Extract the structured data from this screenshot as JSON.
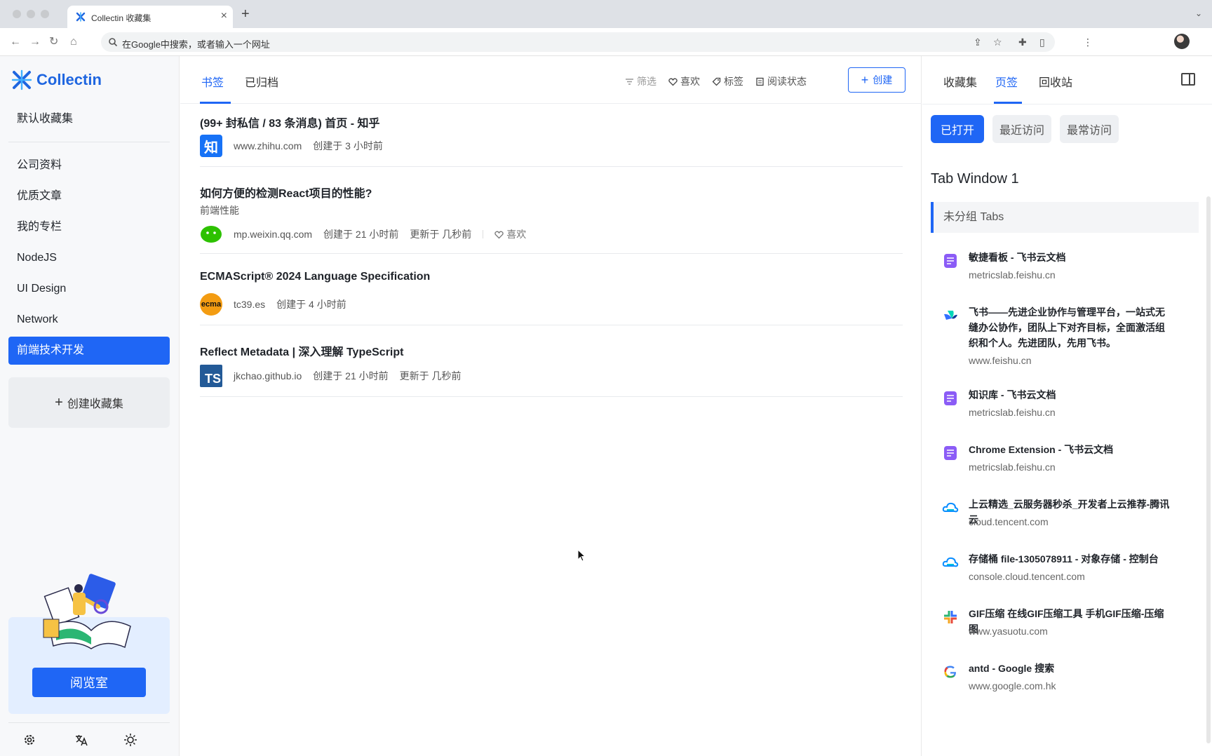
{
  "browser": {
    "tab_title": "Collectin 收藏集",
    "omnibox_placeholder": "在Google中搜索，或者输入一个网址"
  },
  "sidebar": {
    "brand": "Collectin",
    "default_collection": "默认收藏集",
    "items": [
      "公司资料",
      "优质文章",
      "我的专栏",
      "NodeJS",
      "UI Design",
      "Network",
      "前端技术开发"
    ],
    "active_index": 6,
    "create_collection": "创建收藏集",
    "reading_room": "阅览室"
  },
  "main": {
    "tabs": [
      "书签",
      "已归档"
    ],
    "toolbar": {
      "filter": "筛选",
      "like": "喜欢",
      "tags": "标签",
      "read_status": "阅读状态",
      "create": "创建"
    },
    "bookmarks": [
      {
        "title": "(99+ 封私信 / 83 条消息) 首页 - 知乎",
        "desc": "",
        "domain": "www.zhihu.com",
        "created": "创建于 3 小时前",
        "updated": "",
        "like": "",
        "favicon": "zhihu-icon"
      },
      {
        "title": "如何方便的检测React项目的性能?",
        "desc": "前端性能",
        "domain": "mp.weixin.qq.com",
        "created": "创建于 21 小时前",
        "updated": "更新于 几秒前",
        "like": "喜欢",
        "favicon": "wechat-icon"
      },
      {
        "title": "ECMAScript® 2024 Language Specification",
        "desc": "",
        "domain": "tc39.es",
        "created": "创建于 4 小时前",
        "updated": "",
        "like": "",
        "favicon": "ecma-icon"
      },
      {
        "title": "Reflect Metadata | 深入理解 TypeScript",
        "desc": "",
        "domain": "jkchao.github.io",
        "created": "创建于 21 小时前",
        "updated": "更新于 几秒前",
        "like": "",
        "favicon": "typescript-icon"
      }
    ],
    "favicon_text": {
      "zhihu": "知",
      "ecma": "ecma",
      "ts": "TS"
    }
  },
  "right_panel": {
    "tabs": [
      "收藏集",
      "页签",
      "回收站"
    ],
    "pills": [
      "已打开",
      "最近访问",
      "最常访问"
    ],
    "window_title": "Tab Window 1",
    "group_title": "未分组 Tabs",
    "open_tabs": [
      {
        "title": "敏捷看板 - 飞书云文档",
        "domain": "metricslab.feishu.cn",
        "icon": "feishu-doc-icon"
      },
      {
        "title": "飞书——先进企业协作与管理平台，一站式无缝办公协作，团队上下对齐目标，全面激活组织和个人。先进团队，先用飞书。",
        "domain": "www.feishu.cn",
        "icon": "feishu-icon"
      },
      {
        "title": "知识库 - 飞书云文档",
        "domain": "metricslab.feishu.cn",
        "icon": "feishu-doc-icon"
      },
      {
        "title": "Chrome Extension - 飞书云文档",
        "domain": "metricslab.feishu.cn",
        "icon": "feishu-doc-icon"
      },
      {
        "title": "上云精选_云服务器秒杀_开发者上云推荐-腾讯云",
        "domain": "cloud.tencent.com",
        "icon": "tencent-cloud-icon"
      },
      {
        "title": "存储桶 file-1305078911 - 对象存储 - 控制台",
        "domain": "console.cloud.tencent.com",
        "icon": "tencent-cloud-icon"
      },
      {
        "title": "GIF压缩 在线GIF压缩工具 手机GIF压缩-压缩图",
        "domain": "www.yasuotu.com",
        "icon": "yasuotu-icon"
      },
      {
        "title": "antd - Google 搜索",
        "domain": "www.google.com.hk",
        "icon": "google-icon"
      }
    ]
  },
  "colors": {
    "accent": "#1f66f5",
    "sidebar_bg": "#f7f8fa",
    "brand": "#1f66e0"
  }
}
